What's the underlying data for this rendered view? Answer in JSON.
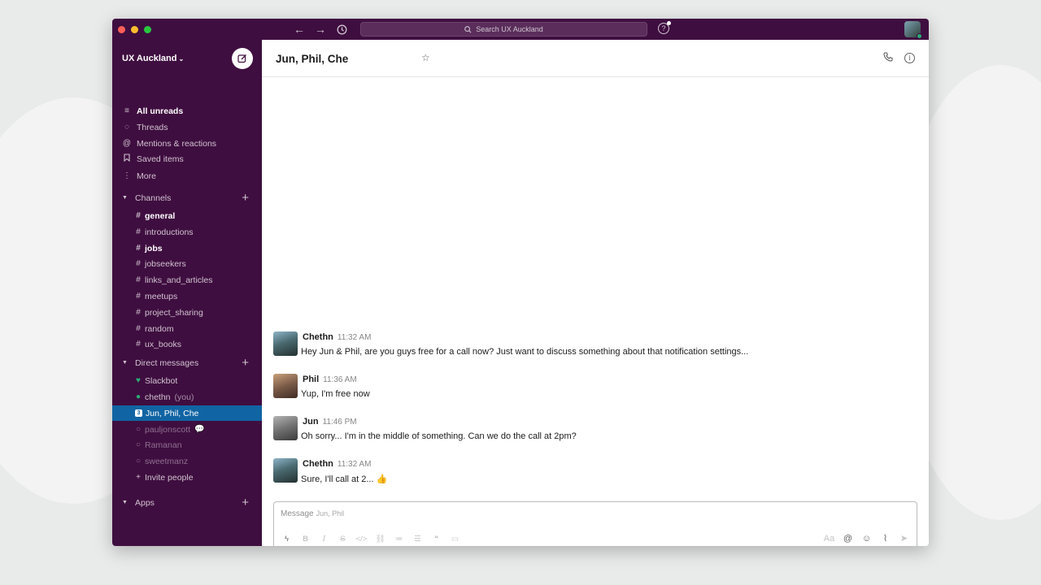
{
  "window": {
    "search_placeholder": "Search UX Auckland"
  },
  "sidebar": {
    "workspace_name": "UX Auckland",
    "nav": [
      {
        "label": "All unreads",
        "icon": "all-unreads-icon",
        "bold": true
      },
      {
        "label": "Threads",
        "icon": "threads-icon"
      },
      {
        "label": "Mentions & reactions",
        "icon": "at-icon"
      },
      {
        "label": "Saved items",
        "icon": "bookmark-icon"
      },
      {
        "label": "More",
        "icon": "more-icon"
      }
    ],
    "channels_header": "Channels",
    "channels": [
      {
        "label": "general",
        "bold": true
      },
      {
        "label": "introductions"
      },
      {
        "label": "jobs",
        "bold": true
      },
      {
        "label": "jobseekers"
      },
      {
        "label": "links_and_articles"
      },
      {
        "label": "meetups"
      },
      {
        "label": "project_sharing"
      },
      {
        "label": "random"
      },
      {
        "label": "ux_books"
      }
    ],
    "dm_header": "Direct messages",
    "dms": [
      {
        "label": "Slackbot",
        "status": "heart"
      },
      {
        "label": "chethn",
        "suffix": "(you)",
        "status": "online"
      },
      {
        "label": "Jun, Phil, Che",
        "status": "count",
        "count": "3",
        "active": true
      },
      {
        "label": "pauljonscott",
        "status": "away",
        "dim": true
      },
      {
        "label": "Ramanan",
        "status": "away",
        "dim": true
      },
      {
        "label": "sweetmanz",
        "status": "away",
        "dim": true
      }
    ],
    "invite_label": "Invite people",
    "apps_header": "Apps"
  },
  "channel": {
    "title": "Jun, Phil, Che"
  },
  "messages": [
    {
      "name": "Chethn",
      "time": "11:32 AM",
      "text": "Hey Jun & Phil, are you guys free for a call now? Just want to discuss something about that notification settings..."
    },
    {
      "name": "Phil",
      "time": "11:36 AM",
      "text": "Yup, I'm free now"
    },
    {
      "name": "Jun",
      "time": "11:46 PM",
      "text": "Oh sorry... I'm in the middle of something. Can we do the call at 2pm?"
    },
    {
      "name": "Chethn",
      "time": "11:32 AM",
      "text": "Sure, I'll call at 2... 👍"
    }
  ],
  "composer": {
    "placeholder": "Message",
    "placeholder_sub": "Jun, Phil"
  },
  "colors": {
    "sidebar": "#3f0e40",
    "active": "#1164a3",
    "online": "#2bac76"
  }
}
